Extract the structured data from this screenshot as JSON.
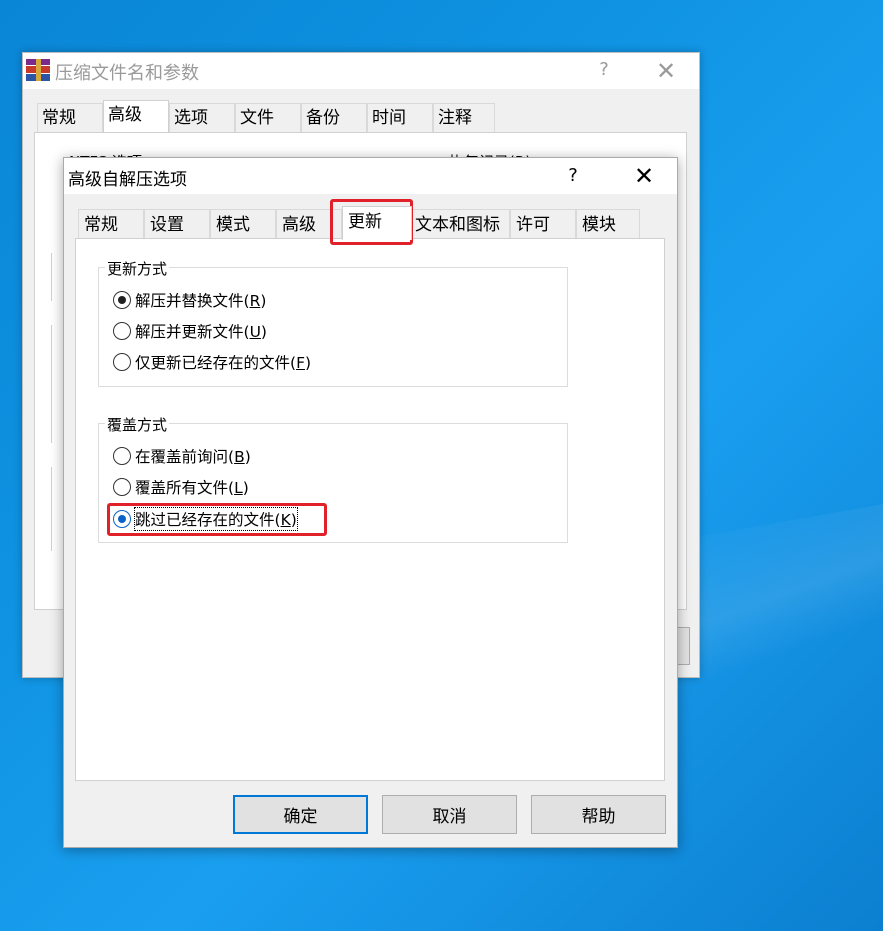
{
  "back_window": {
    "title": "压缩文件名和参数",
    "help": "?",
    "close": "✕",
    "tabs": [
      "常规",
      "高级",
      "选项",
      "文件",
      "备份",
      "时间",
      "注释"
    ],
    "partial_text_left": "NTFS 选项",
    "partial_text_right": "恢复记录(R)..."
  },
  "dialog": {
    "title": "高级自解压选项",
    "help": "?",
    "close": "✕",
    "tabs": [
      "常规",
      "设置",
      "模式",
      "高级",
      "更新",
      "文本和图标",
      "许可",
      "模块"
    ],
    "active_tab": "更新",
    "update_group": {
      "label": "更新方式",
      "options": [
        {
          "text": "解压并替换文件(",
          "key": "R",
          "close": ")",
          "checked": true
        },
        {
          "text": "解压并更新文件(",
          "key": "U",
          "close": ")",
          "checked": false
        },
        {
          "text": "仅更新已经存在的文件(",
          "key": "F",
          "close": ")",
          "checked": false
        }
      ]
    },
    "overwrite_group": {
      "label": "覆盖方式",
      "options": [
        {
          "text": "在覆盖前询问(",
          "key": "B",
          "close": ")",
          "checked": false
        },
        {
          "text": "覆盖所有文件(",
          "key": "L",
          "close": ")",
          "checked": false
        },
        {
          "text": "跳过已经存在的文件(",
          "key": "K",
          "close": ")",
          "checked": true
        }
      ]
    },
    "buttons": {
      "ok": "确定",
      "cancel": "取消",
      "help": "帮助"
    }
  },
  "colors": {
    "highlight": "#e0212a",
    "accent": "#0078d7"
  }
}
